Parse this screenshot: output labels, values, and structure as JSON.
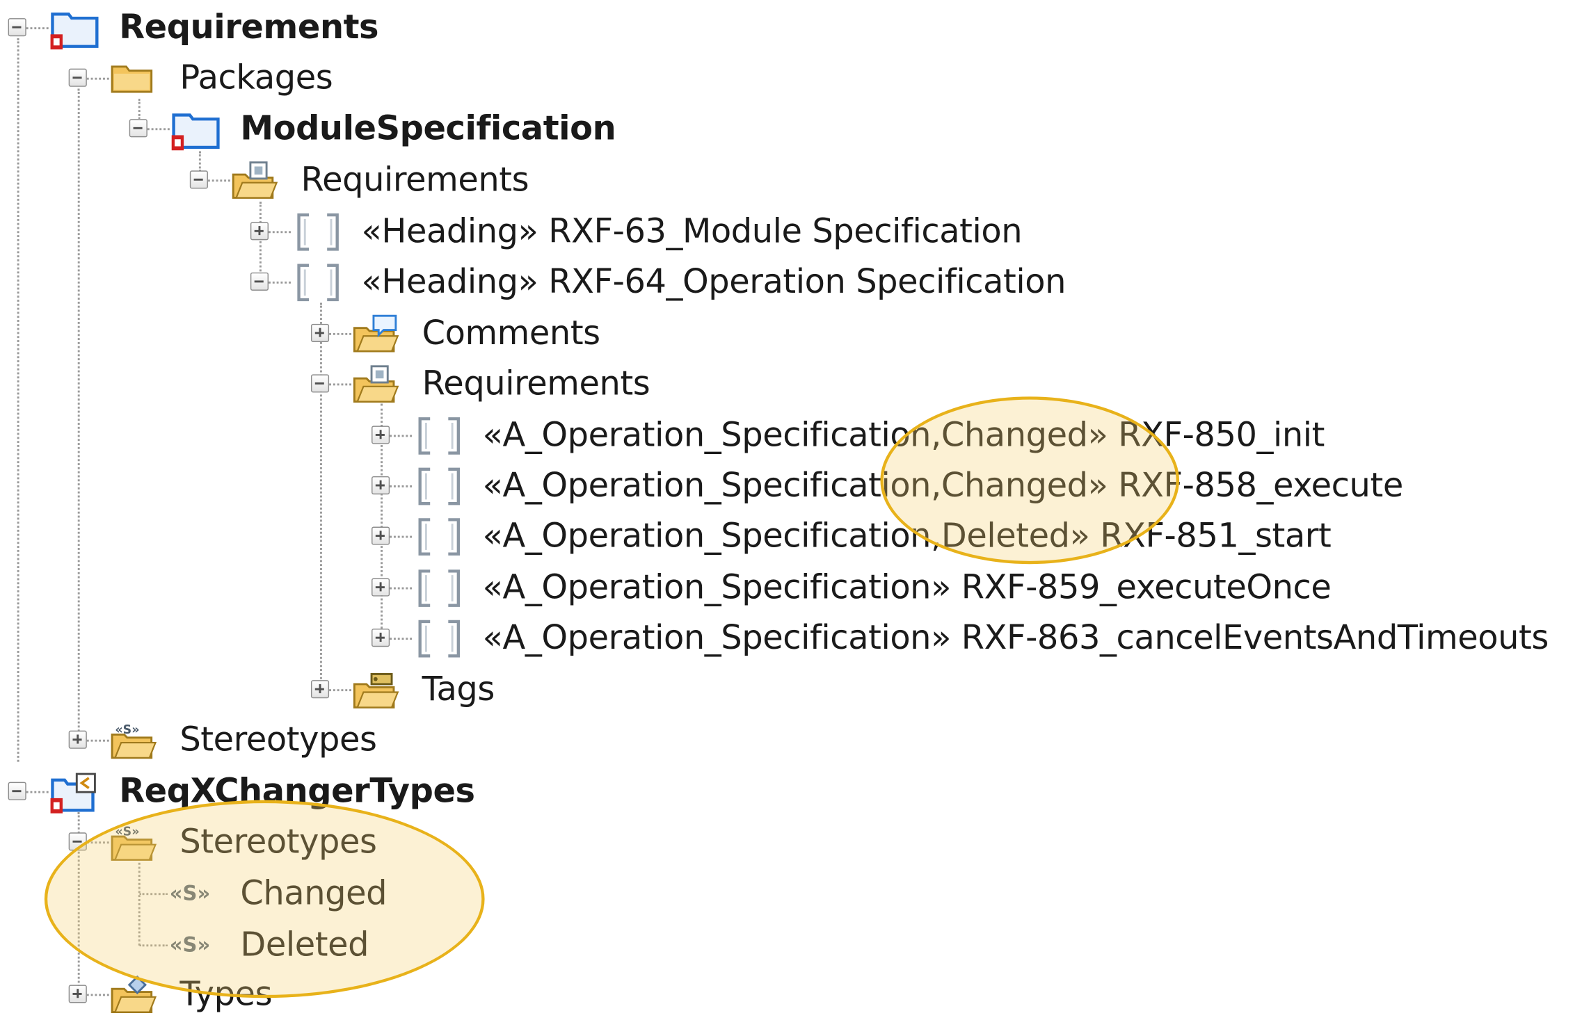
{
  "tree": {
    "requirements_root": {
      "label": "Requirements"
    },
    "packages": {
      "label": "Packages"
    },
    "module_specification": {
      "label": "ModuleSpecification"
    },
    "requirements_folder": {
      "label": "Requirements"
    },
    "heading_63": {
      "label": "«Heading» RXF-63_Module Specification"
    },
    "heading_64": {
      "label": "«Heading» RXF-64_Operation Specification"
    },
    "comments": {
      "label": "Comments"
    },
    "requirements_sub": {
      "label": "Requirements"
    },
    "requirement_items": [
      {
        "label": "«A_Operation_Specification,Changed» RXF-850_init"
      },
      {
        "label": "«A_Operation_Specification,Changed» RXF-858_execute"
      },
      {
        "label": "«A_Operation_Specification,Deleted» RXF-851_start"
      },
      {
        "label": "«A_Operation_Specification» RXF-859_executeOnce"
      },
      {
        "label": "«A_Operation_Specification» RXF-863_cancelEventsAndTimeouts"
      }
    ],
    "tags": {
      "label": "Tags"
    },
    "stereotypes_1": {
      "label": "Stereotypes"
    },
    "reqxchanger_types": {
      "label": "ReqXChangerTypes"
    },
    "stereotypes_2": {
      "label": "Stereotypes"
    },
    "stereotype_changed": {
      "label": "Changed",
      "icon_text": "«S»"
    },
    "stereotype_deleted": {
      "label": "Deleted",
      "icon_text": "«S»"
    },
    "types": {
      "label": "Types"
    }
  },
  "icons": {
    "package": "package-icon",
    "folder": "folder-icon",
    "requirement_folder": "requirement-folder-icon",
    "requirement": "requirement-bracket-icon",
    "comment_folder": "comment-folder-icon",
    "tag_folder": "tag-folder-icon",
    "stereotype_folder": "stereotype-folder-icon",
    "profile": "profile-icon",
    "stereotype": "stereotype-icon",
    "type_folder": "type-folder-icon"
  },
  "colors": {
    "highlight_border": "#e8b21a",
    "highlight_fill": "#f6d070",
    "package_blue": "#1f6fd1",
    "folder_yellow": "#f3c45c",
    "package_red_marker": "#d32020"
  }
}
